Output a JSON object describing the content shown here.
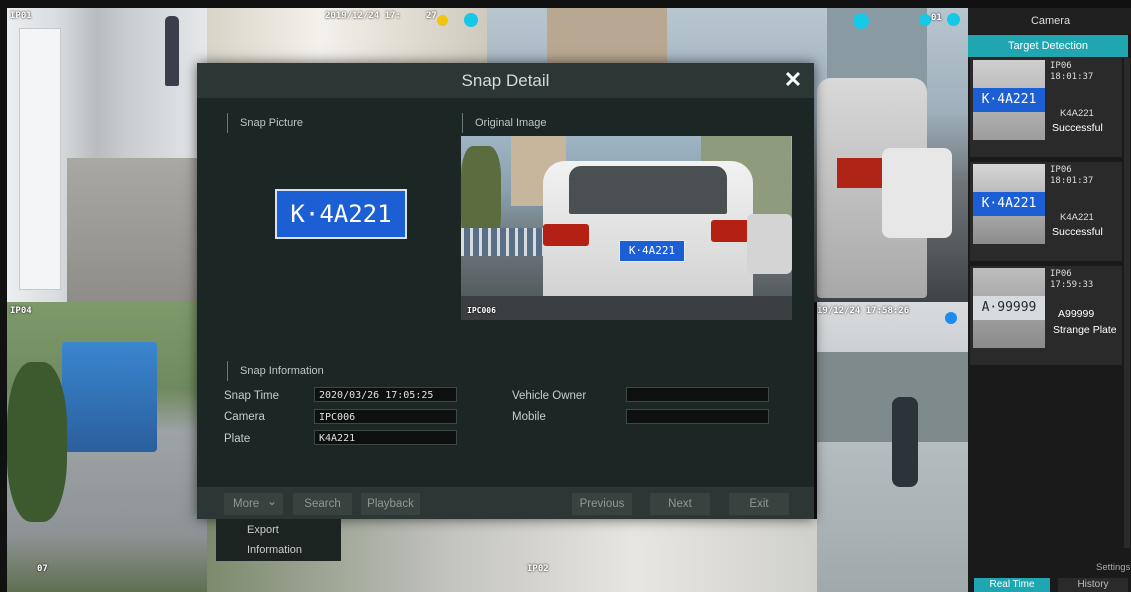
{
  "modal": {
    "title": "Snap Detail",
    "close_glyph": "✕",
    "snap_picture_label": "Snap Picture",
    "original_image_label": "Original Image",
    "snap_plate_text": "K·4A221",
    "original_plate_text": "K·4A221",
    "original_watermark": "IPC006",
    "snap_info_label": "Snap Information",
    "fields": {
      "snap_time_label": "Snap Time",
      "snap_time_value": "2020/03/26 17:05:25",
      "camera_label": "Camera",
      "camera_value": "IPC006",
      "plate_label": "Plate",
      "plate_value": "K4A221",
      "vehicle_owner_label": "Vehicle Owner",
      "vehicle_owner_value": "",
      "mobile_label": "Mobile",
      "mobile_value": ""
    },
    "footer": {
      "more_label": "More",
      "more_chevron": "⌄",
      "search_label": "Search",
      "playback_label": "Playback",
      "previous_label": "Previous",
      "next_label": "Next",
      "exit_label": "Exit"
    },
    "more_menu": {
      "export_label": "Export",
      "information_label": "Information"
    }
  },
  "video_wall": {
    "tile1_label": "IP01",
    "tile1_timestamp": "2019/12/24 17:",
    "tile1_counter": "27",
    "tile_topright_counter": "01",
    "tile4_label": "IP04",
    "tile_br_timestamp": "19/12/24 17:58:26",
    "tile_bottom_label": "IP02",
    "tile_bl_label": "07"
  },
  "panel": {
    "camera_label": "Camera",
    "target_detection_label": "Target Detection",
    "cards": [
      {
        "cam": "IP06",
        "time": "18:01:37",
        "plate": "K4A221",
        "status": "Successful",
        "thumb_text": "K·4A221"
      },
      {
        "cam": "IP06",
        "time": "18:01:37",
        "plate": "K4A221",
        "status": "Successful",
        "thumb_text": "K·4A221"
      },
      {
        "cam": "IP06",
        "time": "17:59:33",
        "plate": "A99999",
        "status": "Strange Plate",
        "thumb_text": "A·99999"
      }
    ],
    "settings_label": "Settings",
    "real_time_label": "Real Time",
    "history_label": "History"
  },
  "colors": {
    "accent_teal": "#1fa6b1",
    "plate_blue": "#1c5fd4",
    "status_cyan": "#14c8e6",
    "status_yellow": "#f2c40c"
  }
}
